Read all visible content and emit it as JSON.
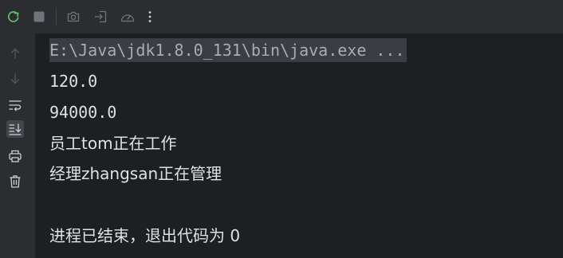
{
  "toolbar": {
    "buttons": [
      {
        "name": "rerun-icon",
        "color": "#5fb865"
      },
      {
        "name": "stop-icon",
        "color": "#6f737a"
      },
      {
        "name": "camera-icon",
        "color": "#6f737a"
      },
      {
        "name": "exit-icon",
        "color": "#6f737a"
      },
      {
        "name": "gauge-icon",
        "color": "#6f737a"
      },
      {
        "name": "more-vertical-icon",
        "color": "#ced0d6"
      }
    ]
  },
  "sidebar": {
    "buttons": [
      {
        "name": "arrow-up-icon"
      },
      {
        "name": "arrow-down-icon"
      },
      {
        "name": "soft-wrap-icon"
      },
      {
        "name": "scroll-to-end-icon",
        "active": true
      },
      {
        "name": "print-icon"
      },
      {
        "name": "trash-icon"
      }
    ]
  },
  "console": {
    "command": "E:\\Java\\jdk1.8.0_131\\bin\\java.exe ...",
    "lines": [
      "120.0",
      "94000.0",
      "员工tom正在工作",
      "经理zhangsan正在管理"
    ],
    "exit_message": "进程已结束，退出代码为 0"
  },
  "colors": {
    "background": "#1e1f22",
    "panel": "#2b2d30",
    "text": "#dfe1e5",
    "command_text": "#a8adb3",
    "command_bg": "#3a3d41",
    "run_green": "#5fb865"
  }
}
